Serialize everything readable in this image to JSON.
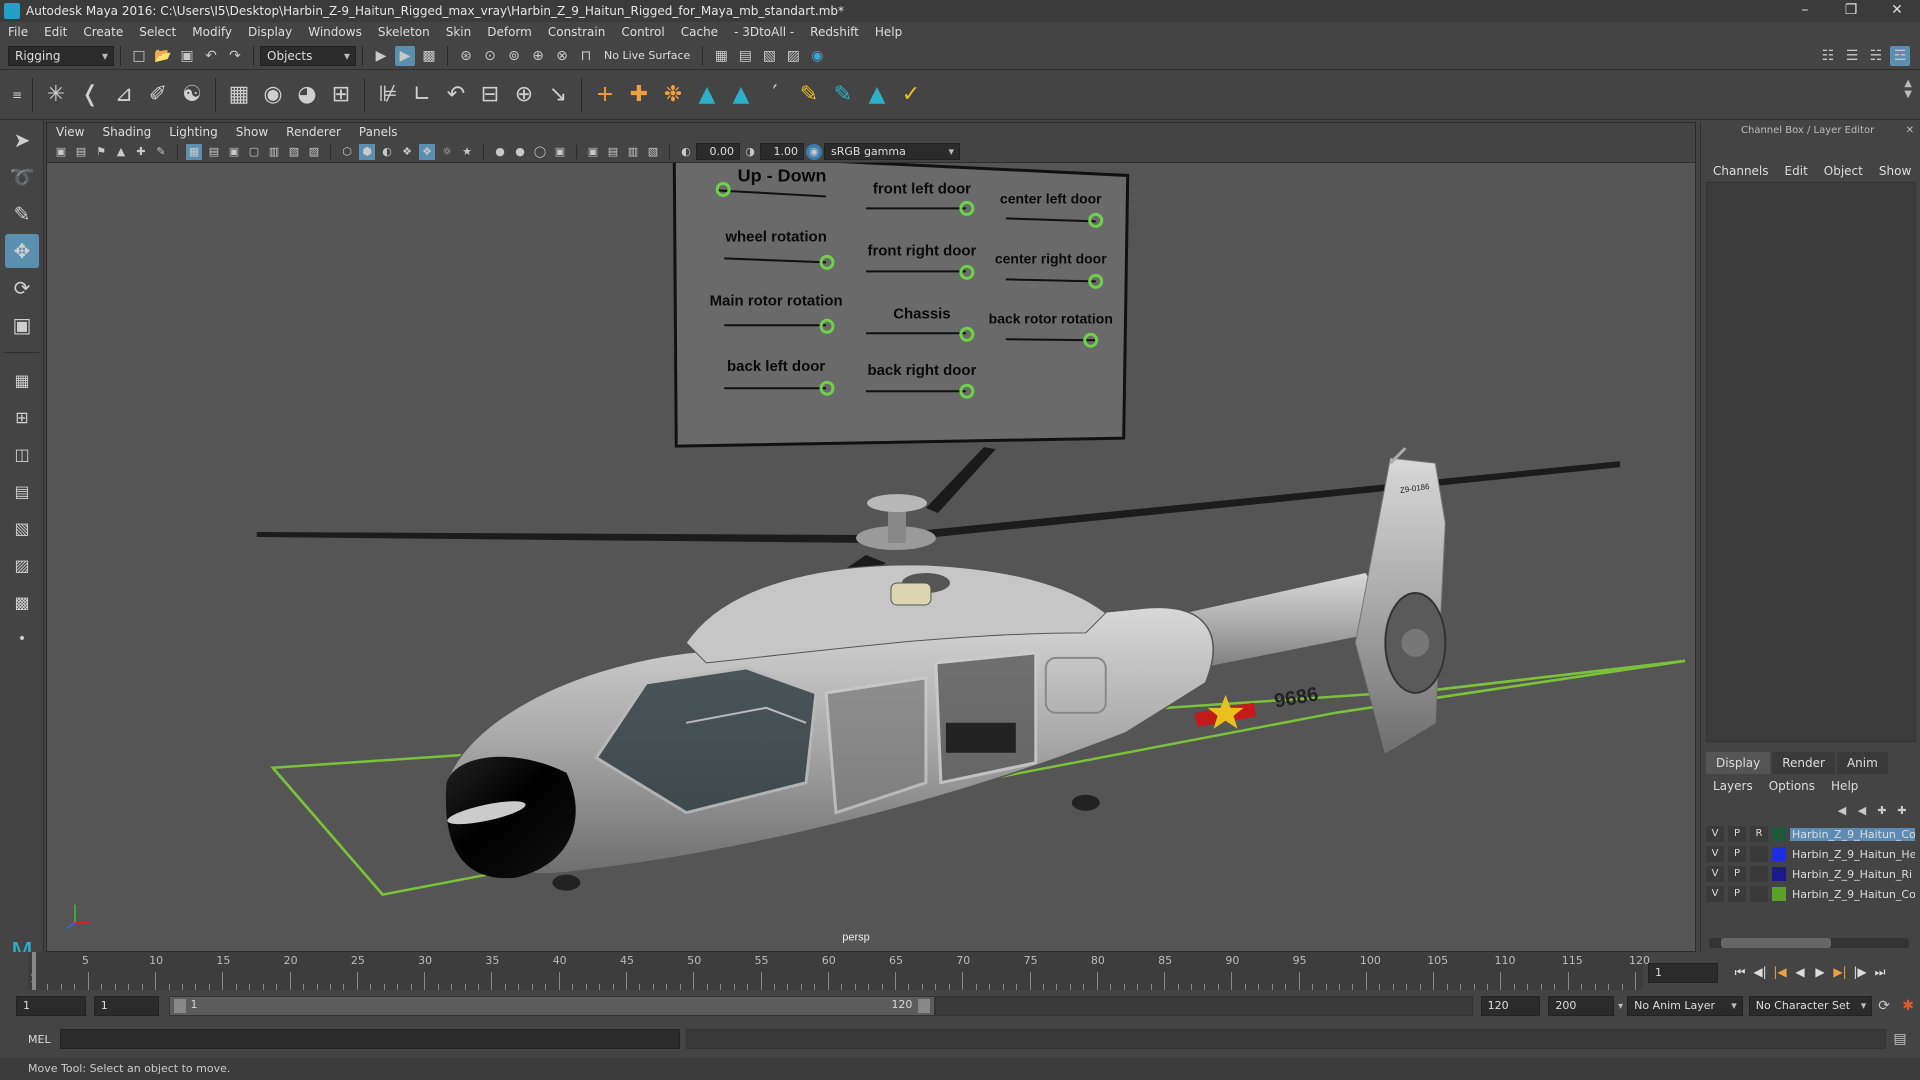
{
  "window": {
    "title": "Autodesk Maya 2016: C:\\Users\\I5\\Desktop\\Harbin_Z-9_Haitun_Rigged_max_vray\\Harbin_Z_9_Haitun_Rigged_for_Maya_mb_standart.mb*",
    "minimize": "–",
    "restore": "❐",
    "close": "✕"
  },
  "menubar": [
    "File",
    "Edit",
    "Create",
    "Select",
    "Modify",
    "Display",
    "Windows",
    "Skeleton",
    "Skin",
    "Deform",
    "Constrain",
    "Control",
    "Cache",
    "- 3DtoAll -",
    "Redshift",
    "Help"
  ],
  "statusline": {
    "menuset": "Rigging",
    "objects_mode": "Objects",
    "live_surface": "No Live Surface"
  },
  "viewport": {
    "menu": [
      "View",
      "Shading",
      "Lighting",
      "Show",
      "Renderer",
      "Panels"
    ],
    "exposure": "0.00",
    "gamma": "1.00",
    "colorspace": "sRGB gamma",
    "camera": "persp",
    "control_board": {
      "labels": [
        "Up - Down",
        "front left door",
        "center left door",
        "wheel rotation",
        "front right door",
        "center right door",
        "Main rotor rotation",
        "Chassis",
        "back rotor rotation",
        "back left door",
        "back right door"
      ]
    },
    "tail_number": "9686",
    "tail_code": "Z9-0186"
  },
  "rightpanel": {
    "header": "Channel Box / Layer Editor",
    "menu": [
      "Channels",
      "Edit",
      "Object",
      "Show"
    ],
    "tabs": [
      "Display",
      "Render",
      "Anim"
    ],
    "layer_menu": [
      "Layers",
      "Options",
      "Help"
    ],
    "layers": [
      {
        "v": "V",
        "p": "P",
        "r": "R",
        "name": "Harbin_Z_9_Haitun_Co",
        "color": "#1e5a3a",
        "selected": true
      },
      {
        "v": "V",
        "p": "P",
        "r": "",
        "name": "Harbin_Z_9_Haitun_He",
        "color": "#1b2fe0",
        "selected": false
      },
      {
        "v": "V",
        "p": "P",
        "r": "",
        "name": "Harbin_Z_9_Haitun_Ri",
        "color": "#1a1a8a",
        "selected": false
      },
      {
        "v": "V",
        "p": "P",
        "r": "",
        "name": "Harbin_Z_9_Haitun_Co",
        "color": "#5aa02a",
        "selected": false
      }
    ]
  },
  "timeline": {
    "ticks": [
      "5",
      "10",
      "15",
      "20",
      "25",
      "30",
      "35",
      "40",
      "45",
      "50",
      "55",
      "60",
      "65",
      "70",
      "75",
      "80",
      "85",
      "90",
      "95",
      "100",
      "105",
      "110",
      "115",
      "120"
    ],
    "start_mark": "1",
    "current_frame": "1"
  },
  "range": {
    "start": "1",
    "anim_start": "1",
    "slider_start": "1",
    "slider_end": "120",
    "range_end": "120",
    "anim_end": "200",
    "anim_layer": "No Anim Layer",
    "char_set": "No Character Set"
  },
  "cmdline": {
    "lang": "MEL"
  },
  "helpline": "Move Tool: Select an object to move."
}
